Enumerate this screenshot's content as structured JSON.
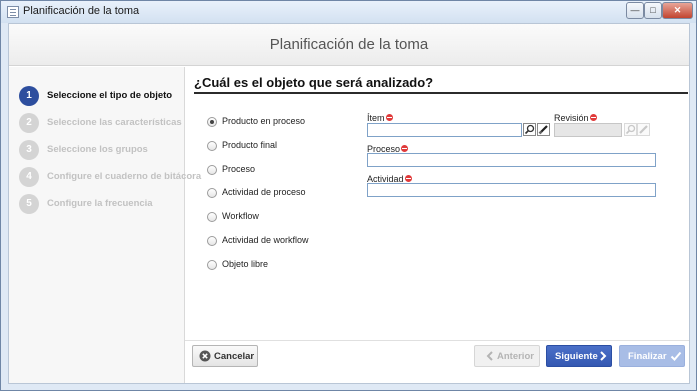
{
  "window": {
    "title": "Planificación de la toma",
    "close_icon": "close-icon",
    "min_icon": "minimize-icon",
    "max_icon": "maximize-icon"
  },
  "header": {
    "title": "Planificación de la toma"
  },
  "steps": [
    {
      "num": "1",
      "label": "Seleccione el tipo de objeto",
      "active": true
    },
    {
      "num": "2",
      "label": "Seleccione las características",
      "active": false
    },
    {
      "num": "3",
      "label": "Seleccione los grupos",
      "active": false
    },
    {
      "num": "4",
      "label": "Configure el cuaderno de bitácora",
      "active": false
    },
    {
      "num": "5",
      "label": "Configure la frecuencia",
      "active": false
    }
  ],
  "main": {
    "title": "¿Cuál es el objeto que será analizado?",
    "options": [
      {
        "label": "Producto en proceso",
        "checked": true
      },
      {
        "label": "Producto final",
        "checked": false
      },
      {
        "label": "Proceso",
        "checked": false
      },
      {
        "label": "Actividad de proceso",
        "checked": false
      },
      {
        "label": "Workflow",
        "checked": false
      },
      {
        "label": "Actividad de workflow",
        "checked": false
      },
      {
        "label": "Objeto libre",
        "checked": false
      }
    ],
    "fields": {
      "item": {
        "label": "Ítem",
        "value": "",
        "required": true
      },
      "revision": {
        "label": "Revisión",
        "value": "",
        "required": true,
        "disabled": true
      },
      "proceso": {
        "label": "Proceso",
        "value": "",
        "required": true
      },
      "actividad": {
        "label": "Actividad",
        "value": "",
        "required": true
      }
    }
  },
  "footer": {
    "cancel": "Cancelar",
    "previous": "Anterior",
    "next": "Siguiente",
    "finish": "Finalizar"
  },
  "colors": {
    "accent": "#2d4e9e",
    "required": "#e03a3a",
    "inactive_step": "#d4d4d4"
  }
}
